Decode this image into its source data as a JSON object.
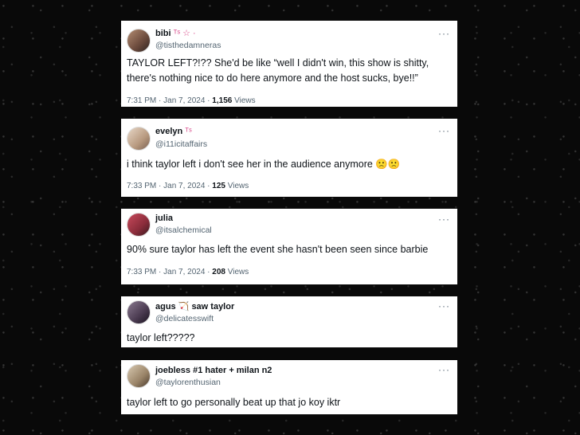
{
  "tweets": [
    {
      "name": "bibi",
      "badge": "ᵀˢ ☆ ·",
      "handle": "@tisthedamneras",
      "text": "TAYLOR LEFT?!?? She'd be like “well I didn't win, this show is shitty, there's nothing nice to do here anymore and the host sucks, bye!!”",
      "time": "7:31 PM · Jan 7, 2024 ·",
      "views": "1,156",
      "views_label": "Views"
    },
    {
      "name": "evelyn",
      "badge": "ᵀˢ",
      "handle": "@i11icitaffairs",
      "text": "i think taylor left i don't see her in the audience anymore 🙁🙁",
      "time": "7:33 PM · Jan 7, 2024 ·",
      "views": "125",
      "views_label": "Views"
    },
    {
      "name": "julia",
      "badge": "",
      "handle": "@itsalchemical",
      "text": "90% sure taylor has left the event she hasn't been seen since barbie",
      "time": "7:33 PM · Jan 7, 2024 ·",
      "views": "208",
      "views_label": "Views"
    },
    {
      "name": "agus",
      "badge": "🏹 saw taylor",
      "handle": "@delicatesswift",
      "text": "taylor left?????"
    },
    {
      "name": "joebless #1 hater + milan n2",
      "badge": "",
      "handle": "@taylorenthusian",
      "text": "taylor left to go personally beat up that jo koy iktr"
    }
  ],
  "menu_glyph": "···"
}
